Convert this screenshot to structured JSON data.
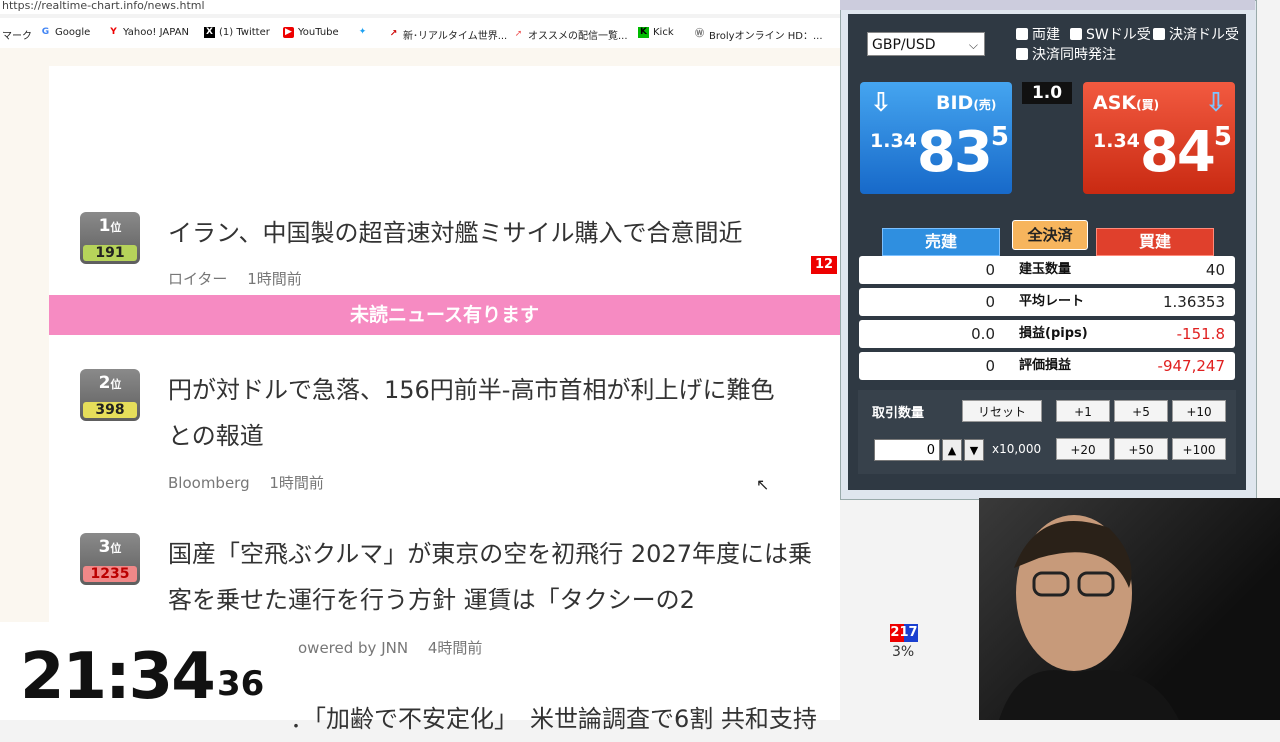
{
  "browser": {
    "url": "https://realtime-chart.info/news.html",
    "bookmarks": [
      {
        "label": "マーク",
        "icon": "folder-icon"
      },
      {
        "label": "Google",
        "icon": "google-icon"
      },
      {
        "label": "Yahoo! JAPAN",
        "icon": "yahoo-icon"
      },
      {
        "label": "(1) Twitter",
        "icon": "x-icon"
      },
      {
        "label": "YouTube",
        "icon": "youtube-icon"
      },
      {
        "label": "",
        "icon": "twitter-bird-icon"
      },
      {
        "label": "新･リアルタイム世界...",
        "icon": "chart-icon"
      },
      {
        "label": "オススメの配信一覧...",
        "icon": "stream-icon"
      },
      {
        "label": "Kick",
        "icon": "kick-icon"
      },
      {
        "label": "Brolyオンライン HD：...",
        "icon": "wordpress-icon"
      }
    ]
  },
  "news": {
    "unread_banner": "未読ニュース有ります",
    "items": [
      {
        "rank": "1",
        "rank_suffix": "位",
        "count": "191",
        "title_lines": [
          "イラン、中国製の超音速対艦ミサイル購入で合意間近"
        ],
        "source": "ロイター",
        "time": "1時間前",
        "badge": "12"
      },
      {
        "rank": "2",
        "rank_suffix": "位",
        "count": "398",
        "title_lines": [
          "円が対ドルで急落、156円前半-高市首相が利上げに難色",
          "との報道"
        ],
        "source": "Bloomberg",
        "time": "1時間前"
      },
      {
        "rank": "3",
        "rank_suffix": "位",
        "count": "1235",
        "title_lines": [
          "国産「空飛ぶクルマ」が東京の空を初飛行 2027年度には乗",
          "客を乗せた運行を行う方針 運賃は「タクシーの2"
        ],
        "source": "owered by JNN",
        "time": "4時間前",
        "badge": "217"
      },
      {
        "title_lines": [
          "：「加齢で不安定化」　米世論調査で6割 共和支持"
        ]
      }
    ],
    "side_percent": "3%"
  },
  "clock": {
    "hm": "21:34",
    "sec": "36"
  },
  "trade": {
    "pair": "GBP/USD",
    "checkboxes": [
      "両建",
      "SWドル受",
      "決済ドル受",
      "決済同時発注"
    ],
    "lot": "1.0",
    "bid": {
      "label": "BID",
      "label_sub": "(売)",
      "prefix": "1.34",
      "main": "83",
      "pip": "5"
    },
    "ask": {
      "label": "ASK",
      "label_sub": "(買)",
      "prefix": "1.34",
      "main": "84",
      "pip": "5"
    },
    "tab_sell": "売建",
    "tab_buy": "買建",
    "close_all": "全決済",
    "rows": [
      {
        "left": "0",
        "label": "建玉数量",
        "right": "40"
      },
      {
        "left": "0",
        "label": "平均レート",
        "right": "1.36353"
      },
      {
        "left": "0.0",
        "label": "損益(pips)",
        "right": "-151.8"
      },
      {
        "left": "0",
        "label": "評価損益",
        "right": "-947,247"
      }
    ],
    "qty_label": "取引数量",
    "reset": "リセット",
    "qty_value": "0",
    "multiplier": "x10,000",
    "increments_row1": [
      "+1",
      "+5",
      "+10"
    ],
    "increments_row2": [
      "+20",
      "+50",
      "+100"
    ]
  },
  "colors": {
    "unread": "#f68bc2",
    "bid": "#1769c9",
    "ask": "#c92a12",
    "negative": "#e02020",
    "close_all": "#f7b55d"
  }
}
